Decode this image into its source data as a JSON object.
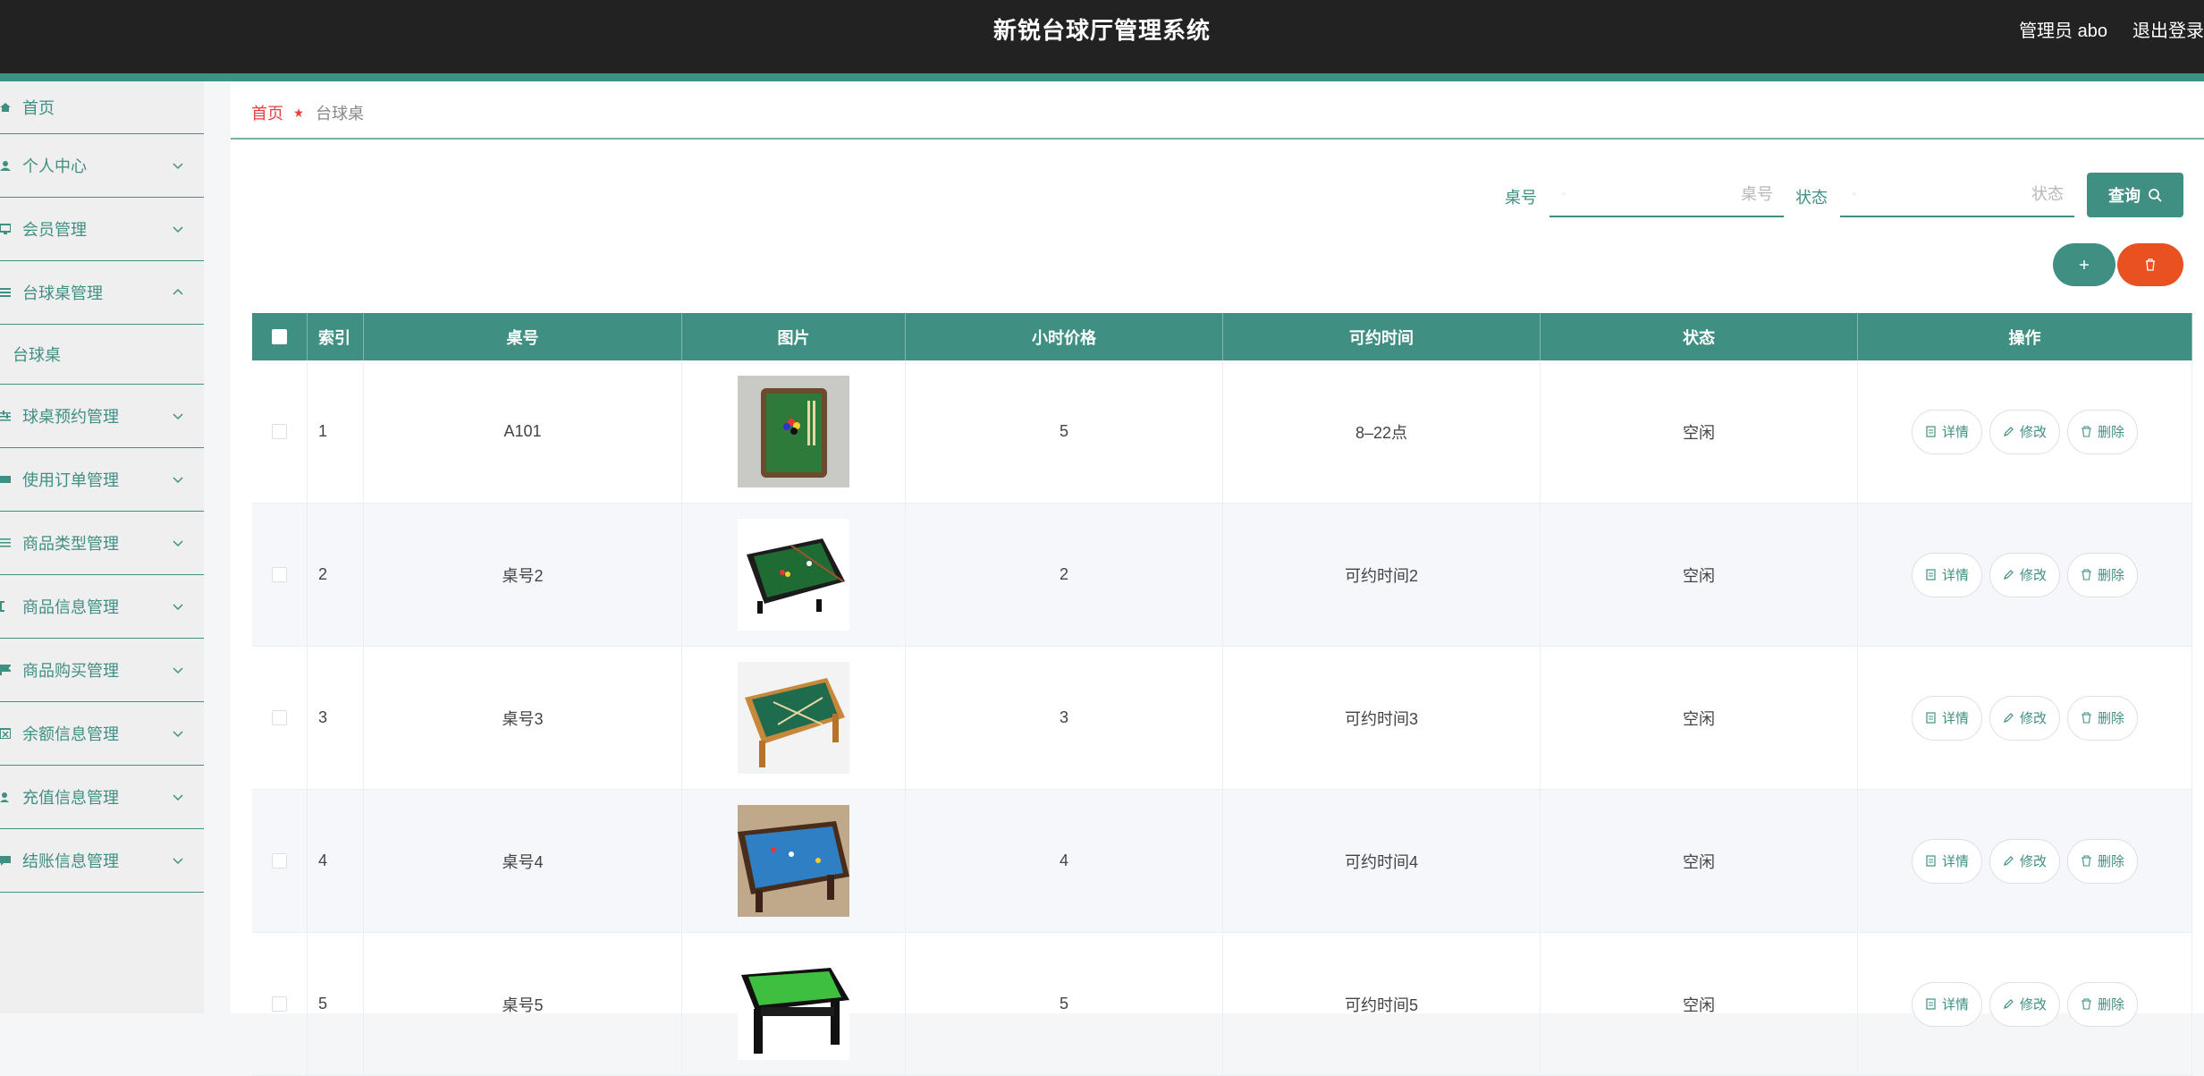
{
  "header": {
    "title": "新锐台球厅管理系统",
    "user": "管理员 abo",
    "logout": "退出登录"
  },
  "sidebar": {
    "items": [
      {
        "label": "首页"
      },
      {
        "label": "个人中心"
      },
      {
        "label": "会员管理"
      },
      {
        "label": "台球桌管理"
      },
      {
        "label": "球桌预约管理"
      },
      {
        "label": "使用订单管理"
      },
      {
        "label": "商品类型管理"
      },
      {
        "label": "商品信息管理"
      },
      {
        "label": "商品购买管理"
      },
      {
        "label": "余额信息管理"
      },
      {
        "label": "充值信息管理"
      },
      {
        "label": "结账信息管理"
      }
    ],
    "sub_item": "台球桌"
  },
  "breadcrumb": {
    "home": "首页",
    "current": "台球桌"
  },
  "search": {
    "table_label": "桌号",
    "table_placeholder": "桌号",
    "status_label": "状态",
    "status_placeholder": "状态",
    "query_label": "查询"
  },
  "table": {
    "headers": [
      "索引",
      "桌号",
      "图片",
      "小时价格",
      "可约时间",
      "状态",
      "操作"
    ],
    "rows": [
      {
        "idx": "1",
        "no": "A101",
        "price": "5",
        "time": "8–22点",
        "status": "空闲"
      },
      {
        "idx": "2",
        "no": "桌号2",
        "price": "2",
        "time": "可约时间2",
        "status": "空闲"
      },
      {
        "idx": "3",
        "no": "桌号3",
        "price": "3",
        "time": "可约时间3",
        "status": "空闲"
      },
      {
        "idx": "4",
        "no": "桌号4",
        "price": "4",
        "time": "可约时间4",
        "status": "空闲"
      },
      {
        "idx": "5",
        "no": "桌号5",
        "price": "5",
        "time": "可约时间5",
        "status": "空闲"
      }
    ],
    "actions": {
      "detail": "详情",
      "edit": "修改",
      "delete": "删除"
    }
  },
  "colors": {
    "accent": "#3f8f83",
    "danger": "#e95120",
    "header_bg": "#222222",
    "breadcrumb_home": "#e8403a"
  }
}
